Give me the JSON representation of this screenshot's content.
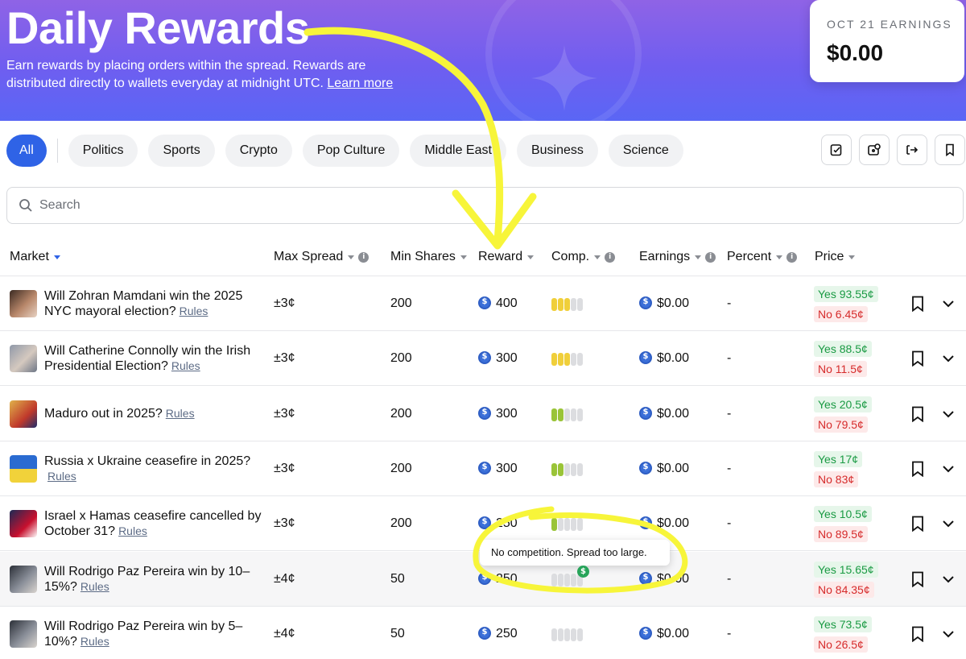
{
  "hero": {
    "title": "Daily Rewards",
    "description": "Earn rewards by placing orders within the spread. Rewards are distributed directly to wallets everyday at midnight UTC.",
    "learn_more": "Learn more"
  },
  "earnings_card": {
    "label": "OCT 21 EARNINGS",
    "value": "$0.00"
  },
  "tabs": [
    "All",
    "Politics",
    "Sports",
    "Crypto",
    "Pop Culture",
    "Middle East",
    "Business",
    "Science"
  ],
  "toolbar_icons": [
    "clipboard-check-icon",
    "wallet-gear-icon",
    "sign-in-icon",
    "bookmark-icon"
  ],
  "search": {
    "placeholder": "Search"
  },
  "columns": {
    "market": "Market",
    "max_spread": "Max Spread",
    "min_shares": "Min Shares",
    "reward": "Reward",
    "comp": "Comp.",
    "earnings": "Earnings",
    "percent": "Percent",
    "price": "Price"
  },
  "rows": [
    {
      "name": "Will Zohran Mamdani win the 2025 NYC mayoral election?",
      "rules": "Rules",
      "max_spread": "±3¢",
      "min_shares": "200",
      "reward": "400",
      "comp_level": 3,
      "comp_color": "#f0cf3a",
      "earnings": "$0.00",
      "percent": "-",
      "yes": "Yes 93.55¢",
      "no": "No 6.45¢"
    },
    {
      "name": "Will Catherine Connolly win the Irish Presidential Election?",
      "rules": "Rules",
      "max_spread": "±3¢",
      "min_shares": "200",
      "reward": "300",
      "comp_level": 3,
      "comp_color": "#f0cf3a",
      "earnings": "$0.00",
      "percent": "-",
      "yes": "Yes 88.5¢",
      "no": "No 11.5¢"
    },
    {
      "name": "Maduro out in 2025?",
      "rules": "Rules",
      "max_spread": "±3¢",
      "min_shares": "200",
      "reward": "300",
      "comp_level": 2,
      "comp_color": "#9ac438",
      "earnings": "$0.00",
      "percent": "-",
      "yes": "Yes 20.5¢",
      "no": "No 79.5¢"
    },
    {
      "name": "Russia x Ukraine ceasefire in 2025?",
      "rules": "Rules",
      "max_spread": "±3¢",
      "min_shares": "200",
      "reward": "300",
      "comp_level": 2,
      "comp_color": "#9ac438",
      "earnings": "$0.00",
      "percent": "-",
      "yes": "Yes 17¢",
      "no": "No 83¢"
    },
    {
      "name": "Israel x Hamas ceasefire cancelled by October 31?",
      "rules": "Rules",
      "max_spread": "±3¢",
      "min_shares": "200",
      "reward": "250",
      "comp_level": 1,
      "comp_color": "#9ac438",
      "earnings": "$0.00",
      "percent": "-",
      "yes": "Yes 10.5¢",
      "no": "No 89.5¢"
    },
    {
      "name": "Will Rodrigo Paz Pereira win by 10–15%?",
      "rules": "Rules",
      "max_spread": "±4¢",
      "min_shares": "50",
      "reward": "250",
      "comp_level": 0,
      "comp_color": "#dcdde0",
      "earnings": "$0.00",
      "percent": "-",
      "yes": "Yes 15.65¢",
      "no": "No 84.35¢"
    },
    {
      "name": "Will Rodrigo Paz Pereira win by 5–10%?",
      "rules": "Rules",
      "max_spread": "±4¢",
      "min_shares": "50",
      "reward": "250",
      "comp_level": 0,
      "comp_color": "#dcdde0",
      "earnings": "$0.00",
      "percent": "-",
      "yes": "Yes 73.5¢",
      "no": "No 26.5¢"
    }
  ],
  "tooltip": {
    "text": "No competition. Spread too large.",
    "badge": "$"
  },
  "colors": {
    "accent": "#2f63e6",
    "yes": "#1a9a43",
    "no": "#d62b2b",
    "annotation": "#f7f53a"
  }
}
